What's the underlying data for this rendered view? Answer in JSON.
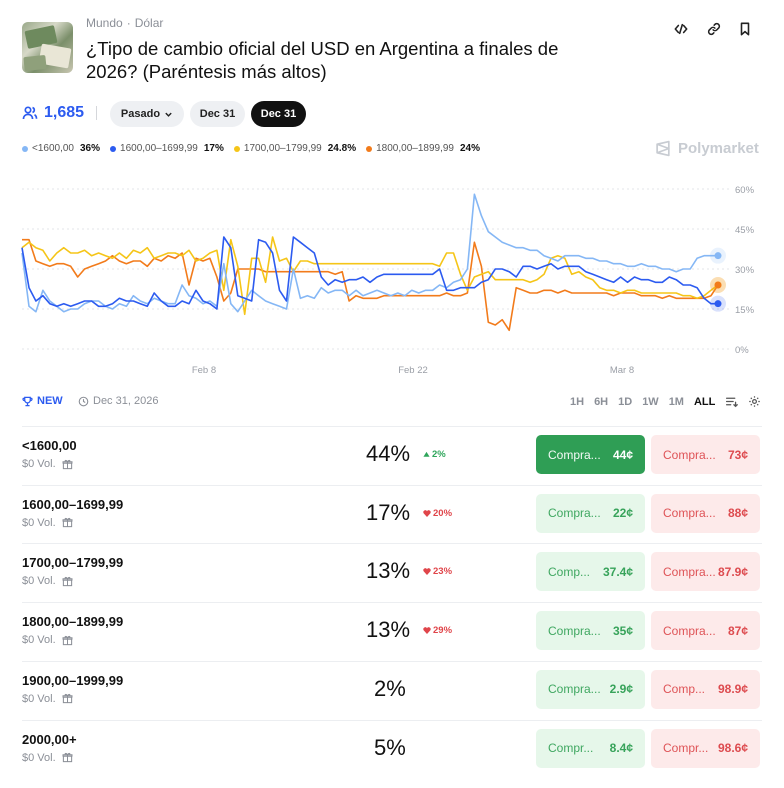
{
  "header": {
    "category": "Mundo",
    "subcategory": "Dólar",
    "title": "¿Tipo de cambio oficial del USD en Argentina a finales de 2026? (Paréntesis más altos)"
  },
  "icons": {
    "embed": "code-icon",
    "link": "link-icon",
    "bookmark": "bookmark-icon"
  },
  "stats": {
    "count": "1,685"
  },
  "filters": [
    {
      "label": "Pasado",
      "style": "gray",
      "dropdown": true
    },
    {
      "label": "Dec 31",
      "style": "gray"
    },
    {
      "label": "Dec 31",
      "style": "dark",
      "selected": true
    }
  ],
  "legend": [
    {
      "label": "<1600,00",
      "pct": "36%",
      "color": "#85b7f5"
    },
    {
      "label": "1600,00–1699,99",
      "pct": "17%",
      "color": "#2c5bf0"
    },
    {
      "label": "1700,00–1799,99",
      "pct": "24.8%",
      "color": "#f5c518"
    },
    {
      "label": "1800,00–1899,99",
      "pct": "24%",
      "color": "#f27b1b"
    }
  ],
  "brand": "Polymarket",
  "chart_data": {
    "type": "line",
    "x_ticks": [
      "Feb 8",
      "Feb 22",
      "Mar 8"
    ],
    "y_ticks": [
      "60%",
      "45%",
      "30%",
      "15%",
      "0%"
    ],
    "ylim": [
      0,
      60
    ],
    "grid": true,
    "series": [
      {
        "name": "<1600,00",
        "color": "#85b7f5",
        "values": [
          36,
          16,
          14,
          22,
          18,
          16,
          14,
          15,
          15,
          17,
          18,
          18,
          16,
          15,
          17,
          16,
          20,
          18,
          17,
          19,
          18,
          17,
          17,
          24,
          20,
          19,
          17,
          18,
          16,
          32,
          17,
          14,
          18,
          22,
          20,
          18,
          17,
          16,
          15,
          30,
          19,
          20,
          19,
          23,
          21,
          22,
          22,
          20,
          22,
          20,
          21,
          22,
          21,
          20,
          21,
          20,
          22,
          21,
          22,
          22,
          24,
          23,
          25,
          26,
          30,
          58,
          50,
          44,
          42,
          40,
          39,
          38,
          38,
          37,
          37,
          35,
          34,
          33,
          35,
          35,
          35,
          34,
          34,
          33,
          33,
          32,
          32,
          31,
          31,
          32,
          31,
          31,
          30,
          30,
          29,
          30,
          30,
          34,
          35,
          35,
          35
        ]
      },
      {
        "name": "1600,00–1699,99",
        "color": "#2c5bf0",
        "values": [
          38,
          23,
          18,
          20,
          17,
          16,
          17,
          16,
          17,
          18,
          18,
          16,
          16,
          17,
          19,
          18,
          18,
          17,
          16,
          21,
          18,
          16,
          16,
          18,
          17,
          22,
          18,
          17,
          15,
          42,
          38,
          20,
          19,
          18,
          41,
          40,
          36,
          22,
          18,
          42,
          40,
          38,
          36,
          27,
          24,
          26,
          25,
          26,
          26,
          27,
          25,
          27,
          28,
          28,
          28,
          28,
          28,
          28,
          28,
          28,
          30,
          22,
          22,
          23,
          23,
          23,
          25,
          26,
          30,
          30,
          29,
          27,
          31,
          31,
          30,
          31,
          32,
          30,
          31,
          31,
          31,
          29,
          28,
          27,
          26,
          25,
          27,
          25,
          27,
          26,
          26,
          25,
          25,
          27,
          26,
          24,
          24,
          23,
          19,
          17,
          17
        ]
      },
      {
        "name": "1700,00–1799,99",
        "color": "#f5c518",
        "values": [
          38,
          40,
          38,
          37,
          33,
          36,
          38,
          36,
          36,
          37,
          35,
          36,
          35,
          34,
          36,
          34,
          37,
          36,
          38,
          34,
          35,
          36,
          36,
          35,
          37,
          33,
          34,
          36,
          37,
          22,
          41,
          31,
          13,
          34,
          34,
          25,
          42,
          33,
          34,
          29,
          33,
          33,
          32,
          32,
          32,
          32,
          32,
          32,
          32,
          32,
          32,
          32,
          32,
          32,
          32,
          32,
          32,
          32,
          32,
          32,
          31,
          36,
          36,
          28,
          22,
          27,
          28,
          29,
          26,
          26,
          26,
          26,
          26,
          25,
          26,
          28,
          34,
          35,
          34,
          28,
          29,
          27,
          26,
          23,
          22,
          22,
          21,
          22,
          22,
          21,
          21,
          21,
          21,
          21,
          21,
          20,
          20,
          19,
          20,
          22,
          24
        ]
      },
      {
        "name": "1800,00–1899,99",
        "color": "#f27b1b",
        "values": [
          41,
          41,
          33,
          32,
          31,
          32,
          32,
          31,
          27,
          30,
          31,
          32,
          33,
          35,
          33,
          32,
          33,
          33,
          31,
          34,
          33,
          35,
          34,
          36,
          24,
          34,
          33,
          34,
          27,
          18,
          21,
          30,
          30,
          30,
          30,
          29,
          29,
          29,
          29,
          29,
          29,
          29,
          29,
          29,
          29,
          28,
          29,
          18,
          20,
          19,
          19,
          19,
          20,
          20,
          20,
          20,
          20,
          20,
          20,
          20,
          20,
          21,
          20,
          20,
          21,
          40,
          31,
          10,
          9,
          11,
          7,
          23,
          22,
          21,
          21,
          22,
          22,
          21,
          22,
          21,
          21,
          21,
          21,
          21,
          21,
          20,
          21,
          21,
          21,
          20,
          20,
          20,
          19,
          20,
          19,
          19,
          19,
          19,
          19,
          20,
          24
        ]
      }
    ]
  },
  "toolbar": {
    "new_label": "NEW",
    "date_label": "Dec 31, 2026",
    "ranges": [
      "1H",
      "6H",
      "1D",
      "1W",
      "1M",
      "ALL"
    ],
    "active_range": "ALL"
  },
  "markets": [
    {
      "name": "<1600,00",
      "volume": "$0 Vol.",
      "prob": "44%",
      "change": "2%",
      "dir": "up",
      "yes_label": "Compra...",
      "yes_price": "44¢",
      "no_label": "Compra...",
      "no_price": "73¢",
      "solid": true
    },
    {
      "name": "1600,00–1699,99",
      "volume": "$0 Vol.",
      "prob": "17%",
      "change": "20%",
      "dir": "down",
      "yes_label": "Compra...",
      "yes_price": "22¢",
      "no_label": "Compra...",
      "no_price": "88¢"
    },
    {
      "name": "1700,00–1799,99",
      "volume": "$0 Vol.",
      "prob": "13%",
      "change": "23%",
      "dir": "down",
      "yes_label": "Comp...",
      "yes_price": "37.4¢",
      "no_label": "Compra...",
      "no_price": "87.9¢"
    },
    {
      "name": "1800,00–1899,99",
      "volume": "$0 Vol.",
      "prob": "13%",
      "change": "29%",
      "dir": "down",
      "yes_label": "Compra...",
      "yes_price": "35¢",
      "no_label": "Compra...",
      "no_price": "87¢"
    },
    {
      "name": "1900,00–1999,99",
      "volume": "$0 Vol.",
      "prob": "2%",
      "change": "",
      "dir": "",
      "yes_label": "Compra...",
      "yes_price": "2.9¢",
      "no_label": "Comp...",
      "no_price": "98.9¢"
    },
    {
      "name": "2000,00+",
      "volume": "$0 Vol.",
      "prob": "5%",
      "change": "",
      "dir": "",
      "yes_label": "Compr...",
      "yes_price": "8.4¢",
      "no_label": "Compr...",
      "no_price": "98.6¢"
    }
  ]
}
